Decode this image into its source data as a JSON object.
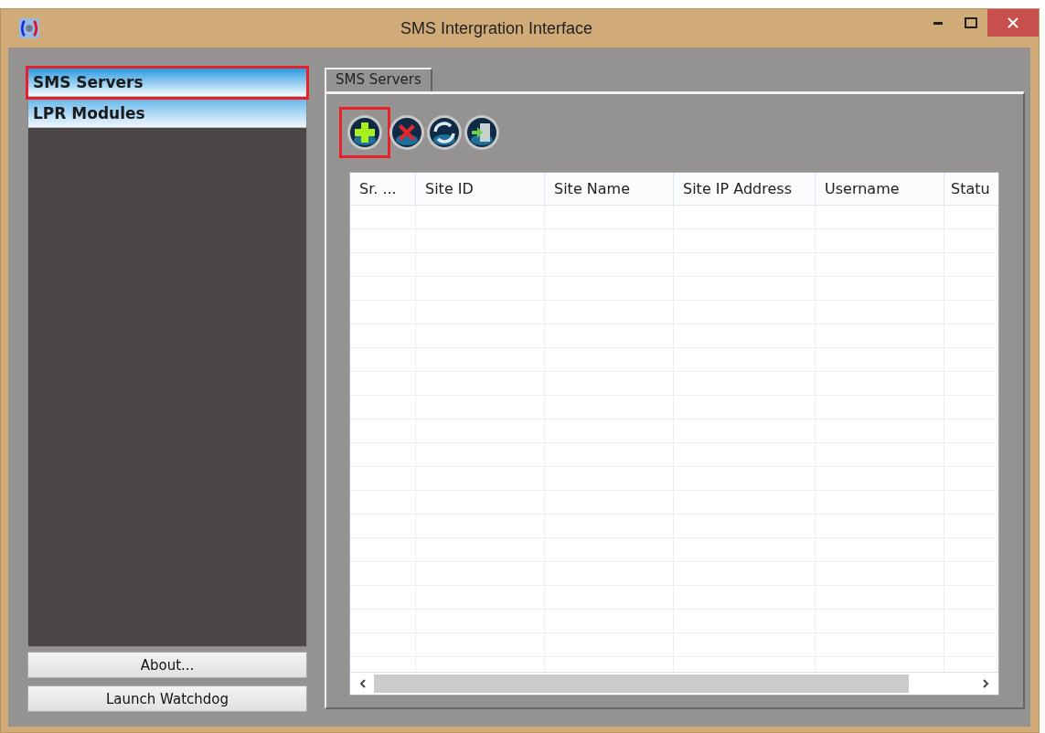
{
  "window": {
    "title": "SMS Intergration Interface"
  },
  "sidebar": {
    "items": [
      {
        "label": "SMS Servers",
        "selected": true,
        "highlighted": true
      },
      {
        "label": "LPR Modules",
        "selected": false,
        "highlighted": false
      }
    ],
    "buttons": [
      "About...",
      "Launch Watchdog"
    ]
  },
  "tabs": [
    {
      "label": "SMS Servers",
      "selected": true
    }
  ],
  "toolbar": [
    {
      "kind": "add",
      "highlighted": true
    },
    {
      "kind": "delete",
      "highlighted": false
    },
    {
      "kind": "refresh",
      "highlighted": false
    },
    {
      "kind": "exit",
      "highlighted": false
    }
  ],
  "table": {
    "columns": [
      "Sr. ...",
      "Site ID",
      "Site Name",
      "Site IP Address",
      "Username",
      "Statu"
    ]
  }
}
